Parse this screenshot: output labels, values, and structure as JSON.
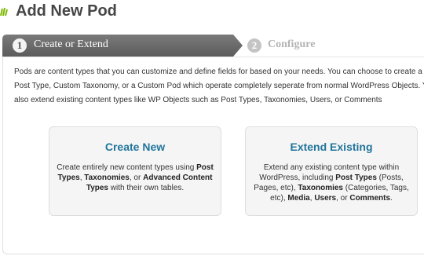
{
  "header": {
    "title": "Add New Pod",
    "logo_icon": "pods-logo-icon"
  },
  "steps": [
    {
      "number": "1",
      "label": "Create or Extend",
      "active": true
    },
    {
      "number": "2",
      "label": "Configure",
      "active": false
    }
  ],
  "intro": {
    "lines": [
      "Pods are content types that you can customize and define fields for based on your needs. You can choose to create a C",
      "Post Type, Custom Taxonomy, or a Custom Pod which operate completely seperate from normal WordPress Objects. Y",
      "also extend existing content types like WP Objects such as Post Types, Taxonomies, Users, or Comments"
    ]
  },
  "cards": {
    "create": {
      "title": "Create New",
      "desc_1": "Create entirely new content types using ",
      "desc_b1": "Post Types",
      "desc_2": ", ",
      "desc_b2": "Taxonomies",
      "desc_3": ", or ",
      "desc_b3": "Advanced Content Types",
      "desc_4": " with their own tables."
    },
    "extend": {
      "title": "Extend Existing",
      "desc_1": "Extend any existing content type within WordPress, including ",
      "desc_b1": "Post Types",
      "desc_2": " (Posts, Pages, etc), ",
      "desc_b2": "Taxonomies",
      "desc_3": " (Categories, Tags, etc), ",
      "desc_b3": "Media",
      "desc_4": ", ",
      "desc_b4": "Users",
      "desc_5": ", or ",
      "desc_b5": "Comments",
      "desc_6": "."
    }
  },
  "colors": {
    "accent": "#21759b",
    "step_active_bg": "#6a6a6a",
    "step_inactive_text": "#b4b4b4"
  }
}
